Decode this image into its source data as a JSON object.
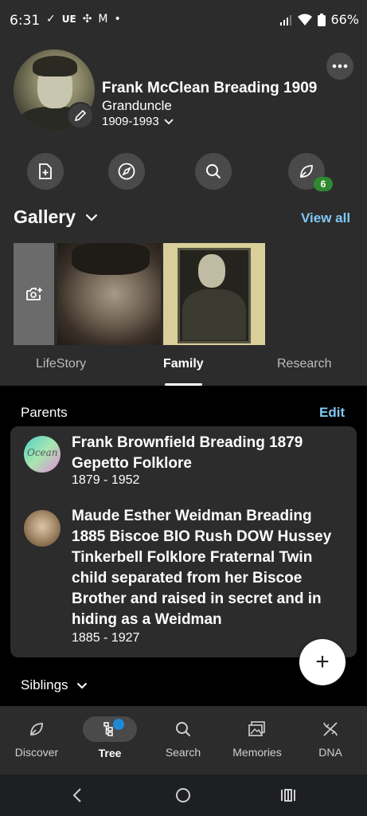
{
  "status_bar": {
    "time": "6:31",
    "left_icons": [
      "✓",
      "UE",
      "✣",
      "M",
      "•"
    ],
    "battery": "66%"
  },
  "profile": {
    "name": "Frank McClean Breading 1909",
    "relation": "Granduncle",
    "years": "1909-1993"
  },
  "actions": [
    "add-record-icon",
    "compass-icon",
    "search-icon",
    "hint-leaf-icon"
  ],
  "hint_count": "6",
  "gallery": {
    "title": "Gallery",
    "view_all": "View all"
  },
  "tabs": [
    {
      "label": "LifeStory",
      "active": false
    },
    {
      "label": "Family",
      "active": true
    },
    {
      "label": "Research",
      "active": false
    }
  ],
  "parents": {
    "title": "Parents",
    "edit": "Edit",
    "items": [
      {
        "name": "Frank Brownfield Breading 1879 Gepetto Folklore",
        "years": "1879 - 1952",
        "avatar_text": "Ocean"
      },
      {
        "name": "Maude Esther Weidman Breading 1885 Biscoe BIO Rush DOW Hussey Tinkerbell Folklore Fraternal Twin child separated from her Biscoe Brother and raised in secret and in hiding as a Weidman",
        "years": "1885 - 1927"
      }
    ]
  },
  "fab": "+",
  "siblings": "Siblings",
  "nav": [
    {
      "label": "Discover",
      "icon": "leaf-icon"
    },
    {
      "label": "Tree",
      "icon": "tree-icon",
      "active": true
    },
    {
      "label": "Search",
      "icon": "search-icon"
    },
    {
      "label": "Memories",
      "icon": "photos-icon"
    },
    {
      "label": "DNA",
      "icon": "dna-icon"
    }
  ],
  "colors": {
    "accent": "#7ec8f5",
    "badge": "#2f8a2f",
    "tree_dot": "#1e8ad6"
  }
}
